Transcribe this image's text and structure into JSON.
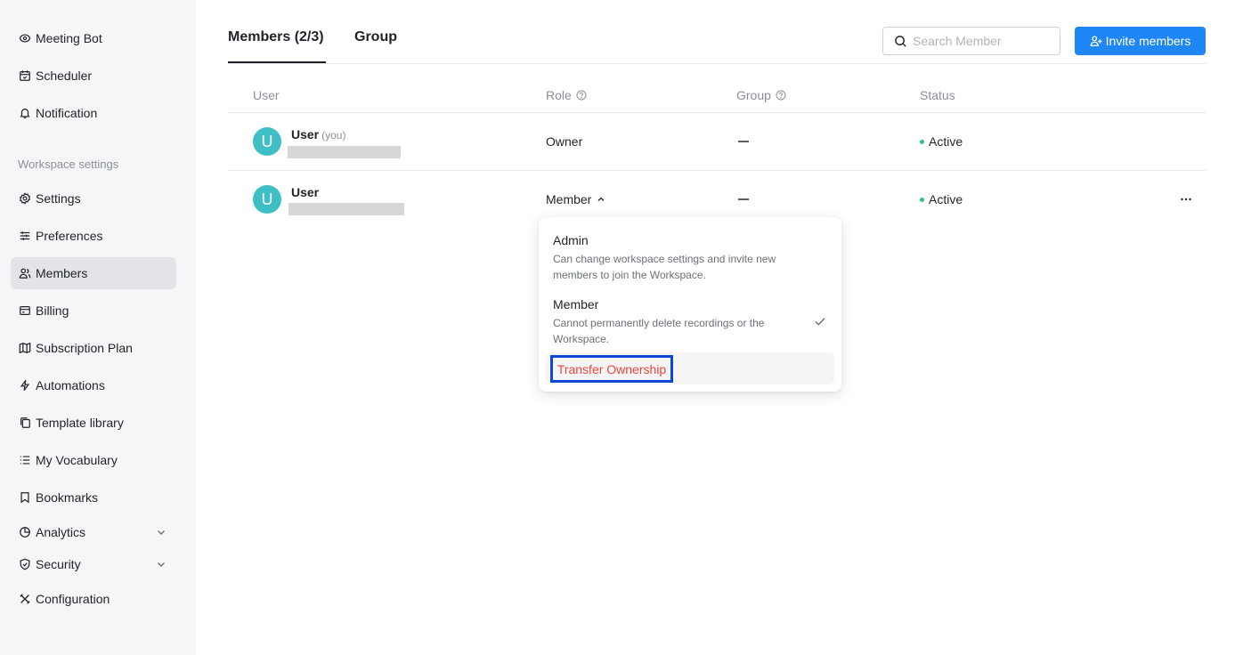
{
  "sidebar": {
    "top_items": [
      {
        "label": "Meeting Bot",
        "icon": "bot-icon"
      },
      {
        "label": "Scheduler",
        "icon": "calendar-icon"
      },
      {
        "label": "Notification",
        "icon": "bell-icon"
      }
    ],
    "section_label": "Workspace settings",
    "items": [
      {
        "label": "Settings",
        "icon": "gear-icon"
      },
      {
        "label": "Preferences",
        "icon": "sliders-icon"
      },
      {
        "label": "Members",
        "icon": "users-icon",
        "active": true
      },
      {
        "label": "Billing",
        "icon": "billing-icon"
      },
      {
        "label": "Subscription Plan",
        "icon": "map-icon"
      },
      {
        "label": "Automations",
        "icon": "lightning-icon"
      },
      {
        "label": "Template library",
        "icon": "template-icon"
      },
      {
        "label": "My Vocabulary",
        "icon": "list-icon"
      },
      {
        "label": "Bookmarks",
        "icon": "bookmark-icon"
      },
      {
        "label": "Analytics",
        "icon": "chart-pie-icon",
        "expandable": true
      },
      {
        "label": "Security",
        "icon": "shield-icon",
        "expandable": true
      },
      {
        "label": "Configuration",
        "icon": "tools-icon"
      }
    ]
  },
  "header": {
    "tabs": [
      {
        "label": "Members (2/3)",
        "active": true
      },
      {
        "label": "Group",
        "active": false
      }
    ],
    "search_placeholder": "Search Member",
    "invite_label": "Invite members"
  },
  "table": {
    "columns": [
      "User",
      "Role",
      "Group",
      "Status"
    ],
    "rows": [
      {
        "avatar": "U",
        "name": "User",
        "you_label": "(you)",
        "role": "Owner",
        "group": "—",
        "status": "Active"
      },
      {
        "avatar": "U",
        "name": "User",
        "role": "Member",
        "group": "—",
        "status": "Active"
      }
    ]
  },
  "role_dropdown": {
    "options": [
      {
        "title": "Admin",
        "description": "Can change workspace settings and invite new members to join the Workspace."
      },
      {
        "title": "Member",
        "description": "Cannot permanently delete recordings or the Workspace.",
        "selected": true
      }
    ],
    "transfer_label": "Transfer Ownership"
  },
  "colors": {
    "accent": "#1f86f5",
    "avatar": "#3ebfc5",
    "active_status": "#2fc57e",
    "danger": "#f0453a",
    "highlight_box": "#0a47d6"
  }
}
